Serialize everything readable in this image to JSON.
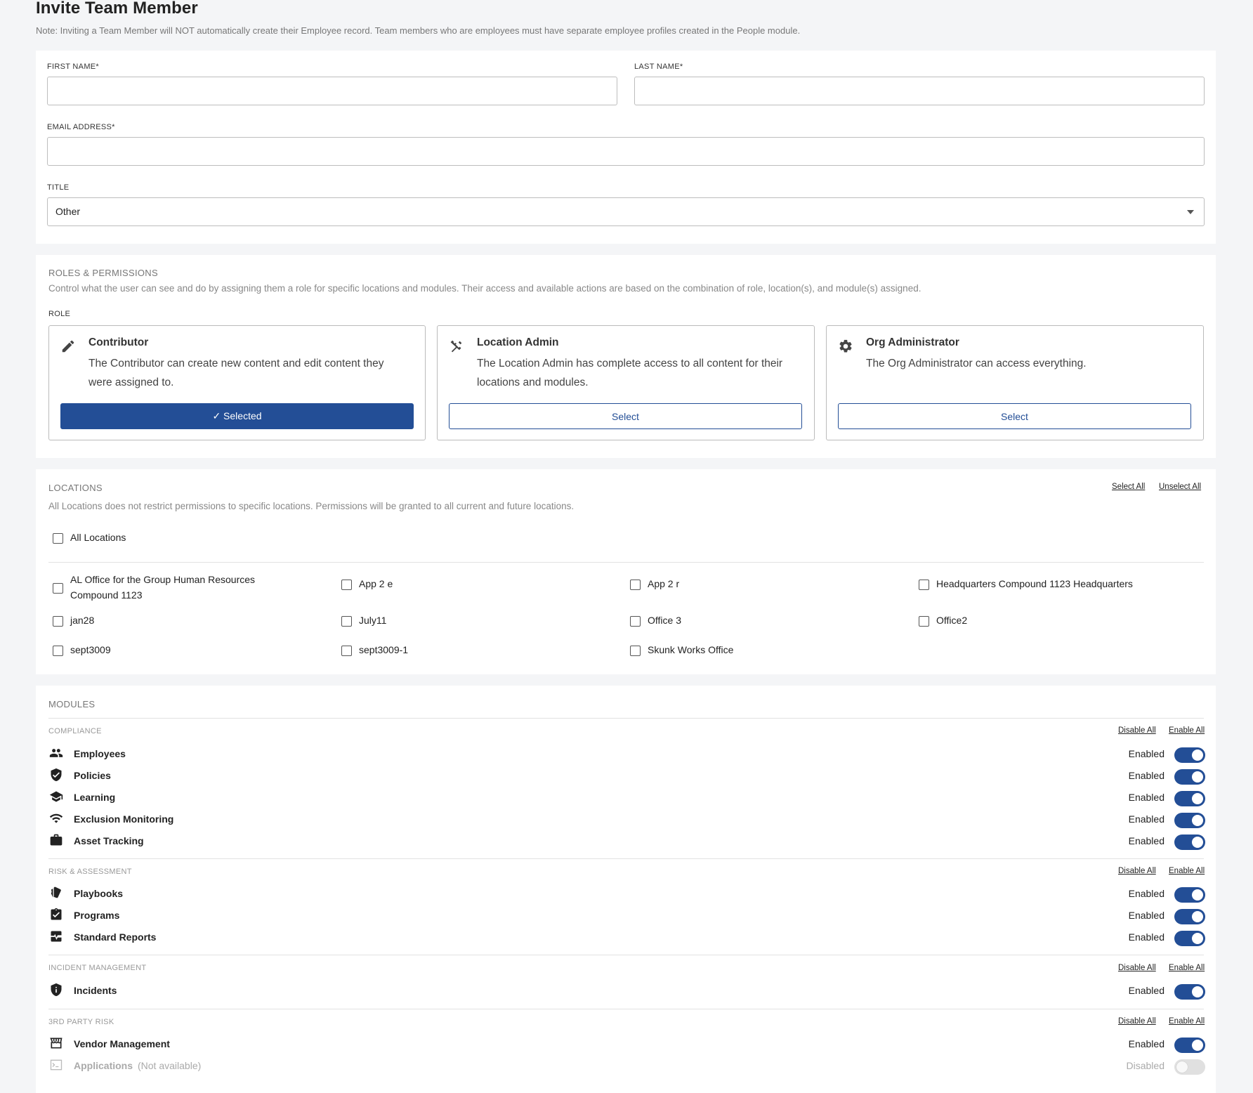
{
  "page": {
    "title": "Invite Team Member",
    "note": "Note: Inviting a Team Member will NOT automatically create their Employee record. Team members who are employees must have separate employee profiles created in the People module."
  },
  "form": {
    "first_name_label": "FIRST NAME*",
    "first_name_value": "",
    "last_name_label": "LAST NAME*",
    "last_name_value": "",
    "email_label": "EMAIL ADDRESS*",
    "email_value": "",
    "title_label": "TITLE",
    "title_value": "Other"
  },
  "roles": {
    "title": "ROLES & PERMISSIONS",
    "description": "Control what the user can see and do by assigning them a role for specific locations and modules. Their access and available actions are based on the combination of role, location(s), and module(s) assigned.",
    "role_label": "ROLE",
    "items": [
      {
        "name": "Contributor",
        "description": "The Contributor can create new content and edit content they were assigned to.",
        "button": "✓  Selected",
        "selected": true,
        "icon": "pencil-icon"
      },
      {
        "name": "Location Admin",
        "description": "The Location Admin has complete access to all content for their locations and modules.",
        "button": "Select",
        "selected": false,
        "icon": "tools-icon"
      },
      {
        "name": "Org Administrator",
        "description": "The Org Administrator can access everything.",
        "button": "Select",
        "selected": false,
        "icon": "gear-icon"
      }
    ]
  },
  "locations": {
    "title": "LOCATIONS",
    "select_all": "Select All",
    "unselect_all": "Unselect All",
    "description": "All Locations does not restrict permissions to specific locations. Permissions will be granted to all current and future locations.",
    "all_label": "All Locations",
    "items": [
      "AL Office for the Group Human Resources Compound 1123",
      "App 2 e",
      "App 2 r",
      "Headquarters Compound 1123 Headquarters",
      "jan28",
      "July11",
      "Office 3",
      "Office2",
      "sept3009",
      "sept3009-1",
      "Skunk Works Office"
    ]
  },
  "modules": {
    "title": "MODULES",
    "disable_all": "Disable All",
    "enable_all": "Enable All",
    "enabled_text": "Enabled",
    "disabled_text": "Disabled",
    "groups": [
      {
        "name": "COMPLIANCE",
        "items": [
          {
            "name": "Employees",
            "icon": "people-icon",
            "status": "Enabled"
          },
          {
            "name": "Policies",
            "icon": "shield-check-icon",
            "status": "Enabled"
          },
          {
            "name": "Learning",
            "icon": "graduation-cap-icon",
            "status": "Enabled"
          },
          {
            "name": "Exclusion Monitoring",
            "icon": "wifi-icon",
            "status": "Enabled"
          },
          {
            "name": "Asset Tracking",
            "icon": "briefcase-icon",
            "status": "Enabled"
          }
        ]
      },
      {
        "name": "RISK & ASSESSMENT",
        "items": [
          {
            "name": "Playbooks",
            "icon": "cards-icon",
            "status": "Enabled"
          },
          {
            "name": "Programs",
            "icon": "clipboard-check-icon",
            "status": "Enabled"
          },
          {
            "name": "Standard Reports",
            "icon": "pulse-report-icon",
            "status": "Enabled"
          }
        ]
      },
      {
        "name": "INCIDENT MANAGEMENT",
        "items": [
          {
            "name": "Incidents",
            "icon": "shield-alert-icon",
            "status": "Enabled"
          }
        ]
      },
      {
        "name": "3RD PARTY RISK",
        "items": [
          {
            "name": "Vendor Management",
            "icon": "storefront-icon",
            "status": "Enabled"
          },
          {
            "name": "Applications",
            "icon": "terminal-window-icon",
            "status": "Disabled",
            "note": "(Not available)"
          }
        ]
      }
    ]
  },
  "colors": {
    "accent": "#234e96",
    "background": "#f4f5f7"
  }
}
